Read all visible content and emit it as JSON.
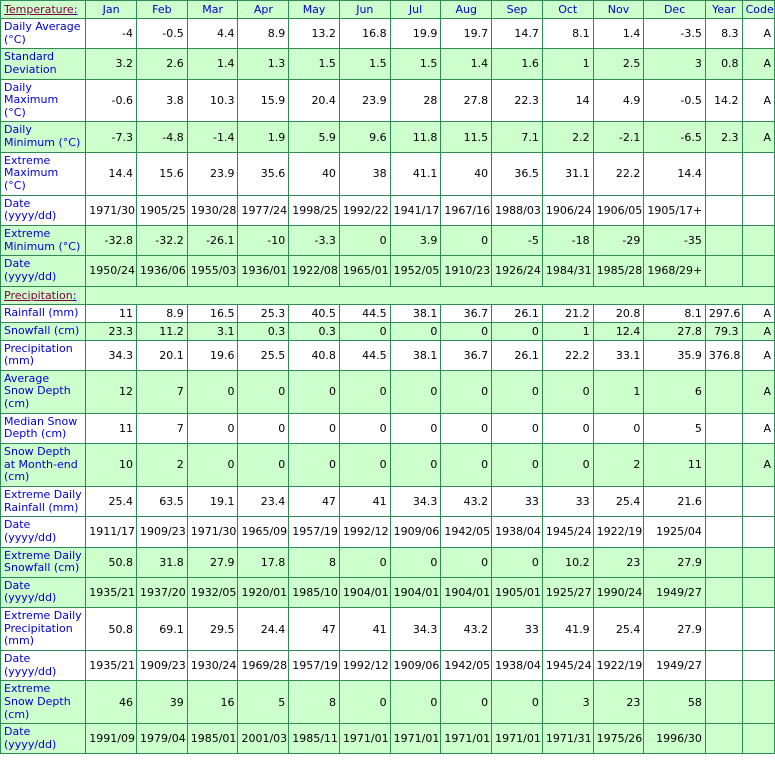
{
  "table": {
    "columns": [
      "Jan",
      "Feb",
      "Mar",
      "Apr",
      "May",
      "Jun",
      "Jul",
      "Aug",
      "Sep",
      "Oct",
      "Nov",
      "Dec",
      "Year",
      "Code"
    ],
    "sections": [
      {
        "title": "Temperature",
        "title_colon": ":",
        "rows": [
          {
            "label": "Daily Average (°C)",
            "shade": "white",
            "values": [
              "-4",
              "-0.5",
              "4.4",
              "8.9",
              "13.2",
              "16.8",
              "19.9",
              "19.7",
              "14.7",
              "8.1",
              "1.4",
              "-3.5",
              "8.3",
              "A"
            ],
            "bold": [
              false,
              false,
              false,
              false,
              false,
              false,
              false,
              false,
              false,
              false,
              false,
              false,
              false,
              false
            ]
          },
          {
            "label": "Standard Deviation",
            "shade": "green",
            "values": [
              "3.2",
              "2.6",
              "1.4",
              "1.3",
              "1.5",
              "1.5",
              "1.5",
              "1.4",
              "1.6",
              "1",
              "2.5",
              "3",
              "0.8",
              "A"
            ],
            "bold": [
              false,
              false,
              false,
              false,
              false,
              false,
              false,
              false,
              false,
              false,
              false,
              false,
              false,
              false
            ]
          },
          {
            "label": "Daily Maximum (°C)",
            "shade": "white",
            "values": [
              "-0.6",
              "3.8",
              "10.3",
              "15.9",
              "20.4",
              "23.9",
              "28",
              "27.8",
              "22.3",
              "14",
              "4.9",
              "-0.5",
              "14.2",
              "A"
            ],
            "bold": [
              false,
              false,
              false,
              false,
              false,
              false,
              false,
              false,
              false,
              false,
              false,
              false,
              false,
              false
            ]
          },
          {
            "label": "Daily Minimum (°C)",
            "shade": "green",
            "values": [
              "-7.3",
              "-4.8",
              "-1.4",
              "1.9",
              "5.9",
              "9.6",
              "11.8",
              "11.5",
              "7.1",
              "2.2",
              "-2.1",
              "-6.5",
              "2.3",
              "A"
            ],
            "bold": [
              false,
              false,
              false,
              false,
              false,
              false,
              false,
              false,
              false,
              false,
              false,
              false,
              false,
              false
            ]
          },
          {
            "label": "Extreme Maximum (°C)",
            "shade": "white",
            "values": [
              "14.4",
              "15.6",
              "23.9",
              "35.6",
              "40",
              "38",
              "41.1",
              "40",
              "36.5",
              "31.1",
              "22.2",
              "14.4",
              "",
              ""
            ],
            "bold": [
              false,
              false,
              false,
              false,
              false,
              false,
              true,
              false,
              false,
              false,
              false,
              false,
              false,
              false
            ]
          },
          {
            "label": "Date (yyyy/dd)",
            "shade": "white",
            "values": [
              "1971/30",
              "1905/25",
              "1930/28",
              "1977/24",
              "1998/25",
              "1992/22",
              "1941/17",
              "1967/16",
              "1988/03",
              "1906/24",
              "1906/05+",
              "1905/17+",
              "",
              ""
            ],
            "bold": [
              false,
              false,
              false,
              false,
              false,
              false,
              true,
              false,
              false,
              false,
              false,
              false,
              false,
              false
            ]
          },
          {
            "label": "Extreme Minimum (°C)",
            "shade": "green",
            "values": [
              "-32.8",
              "-32.2",
              "-26.1",
              "-10",
              "-3.3",
              "0",
              "3.9",
              "0",
              "-5",
              "-18",
              "-29",
              "-35",
              "",
              ""
            ],
            "bold": [
              false,
              false,
              false,
              false,
              false,
              false,
              false,
              false,
              false,
              false,
              false,
              true,
              false,
              false
            ]
          },
          {
            "label": "Date (yyyy/dd)",
            "shade": "green",
            "values": [
              "1950/24",
              "1936/06",
              "1955/03",
              "1936/01",
              "1922/08+",
              "1965/01",
              "1952/05+",
              "1910/23",
              "1926/24",
              "1984/31",
              "1985/28",
              "1968/29+",
              "",
              ""
            ],
            "bold": [
              false,
              false,
              false,
              false,
              false,
              false,
              false,
              false,
              false,
              false,
              false,
              true,
              false,
              false
            ]
          }
        ]
      },
      {
        "title": "Precipitation",
        "title_colon": ":",
        "rows": [
          {
            "label": "Rainfall (mm)",
            "shade": "white",
            "values": [
              "11",
              "8.9",
              "16.5",
              "25.3",
              "40.5",
              "44.5",
              "38.1",
              "36.7",
              "26.1",
              "21.2",
              "20.8",
              "8.1",
              "297.6",
              "A"
            ],
            "bold": [
              false,
              false,
              false,
              false,
              false,
              false,
              false,
              false,
              false,
              false,
              false,
              false,
              false,
              false
            ]
          },
          {
            "label": "Snowfall (cm)",
            "shade": "green",
            "values": [
              "23.3",
              "11.2",
              "3.1",
              "0.3",
              "0.3",
              "0",
              "0",
              "0",
              "0",
              "1",
              "12.4",
              "27.8",
              "79.3",
              "A"
            ],
            "bold": [
              false,
              false,
              false,
              false,
              false,
              false,
              false,
              false,
              false,
              false,
              false,
              false,
              false,
              false
            ]
          },
          {
            "label": "Precipitation (mm)",
            "shade": "white",
            "values": [
              "34.3",
              "20.1",
              "19.6",
              "25.5",
              "40.8",
              "44.5",
              "38.1",
              "36.7",
              "26.1",
              "22.2",
              "33.1",
              "35.9",
              "376.8",
              "A"
            ],
            "bold": [
              false,
              false,
              false,
              false,
              false,
              false,
              false,
              false,
              false,
              false,
              false,
              false,
              false,
              false
            ]
          },
          {
            "label": "Average Snow Depth (cm)",
            "shade": "green",
            "values": [
              "12",
              "7",
              "0",
              "0",
              "0",
              "0",
              "0",
              "0",
              "0",
              "0",
              "1",
              "6",
              "",
              "A"
            ],
            "bold": [
              false,
              false,
              false,
              false,
              false,
              false,
              false,
              false,
              false,
              false,
              false,
              false,
              false,
              false
            ]
          },
          {
            "label": "Median Snow Depth (cm)",
            "shade": "white",
            "values": [
              "11",
              "7",
              "0",
              "0",
              "0",
              "0",
              "0",
              "0",
              "0",
              "0",
              "0",
              "5",
              "",
              "A"
            ],
            "bold": [
              false,
              false,
              false,
              false,
              false,
              false,
              false,
              false,
              false,
              false,
              false,
              false,
              false,
              false
            ]
          },
          {
            "label": "Snow Depth at Month-end (cm)",
            "shade": "green",
            "values": [
              "10",
              "2",
              "0",
              "0",
              "0",
              "0",
              "0",
              "0",
              "0",
              "0",
              "2",
              "11",
              "",
              "A"
            ],
            "bold": [
              false,
              false,
              false,
              false,
              false,
              false,
              false,
              false,
              false,
              false,
              false,
              false,
              false,
              false
            ]
          },
          {
            "label": "Extreme Daily Rainfall (mm)",
            "shade": "white",
            "values": [
              "25.4",
              "63.5",
              "19.1",
              "23.4",
              "47",
              "41",
              "34.3",
              "43.2",
              "33",
              "33",
              "25.4",
              "21.6",
              "",
              ""
            ],
            "bold": [
              false,
              true,
              false,
              false,
              false,
              false,
              false,
              false,
              false,
              false,
              false,
              false,
              false,
              false
            ]
          },
          {
            "label": "Date (yyyy/dd)",
            "shade": "white",
            "values": [
              "1911/17",
              "1909/23",
              "1971/30",
              "1965/09",
              "1957/19",
              "1992/12",
              "1909/06",
              "1942/05",
              "1938/04",
              "1945/24",
              "1922/19",
              "1925/04",
              "",
              ""
            ],
            "bold": [
              false,
              true,
              false,
              false,
              false,
              false,
              false,
              false,
              false,
              false,
              false,
              false,
              false,
              false
            ]
          },
          {
            "label": "Extreme Daily Snowfall (cm)",
            "shade": "green",
            "values": [
              "50.8",
              "31.8",
              "27.9",
              "17.8",
              "8",
              "0",
              "0",
              "0",
              "0",
              "10.2",
              "23",
              "27.9",
              "",
              ""
            ],
            "bold": [
              true,
              false,
              false,
              false,
              false,
              false,
              false,
              false,
              false,
              false,
              false,
              false,
              false,
              false
            ]
          },
          {
            "label": "Date (yyyy/dd)",
            "shade": "green",
            "values": [
              "1935/21",
              "1937/20",
              "1932/05",
              "1920/01",
              "1985/10",
              "1904/01+",
              "1904/01+",
              "1904/01+",
              "1905/01+",
              "1925/27",
              "1990/24",
              "1949/27",
              "",
              ""
            ],
            "bold": [
              true,
              false,
              false,
              false,
              false,
              false,
              false,
              false,
              false,
              false,
              false,
              false,
              false,
              false
            ]
          },
          {
            "label": "Extreme Daily Precipitation (mm)",
            "shade": "white",
            "values": [
              "50.8",
              "69.1",
              "29.5",
              "24.4",
              "47",
              "41",
              "34.3",
              "43.2",
              "33",
              "41.9",
              "25.4",
              "27.9",
              "",
              ""
            ],
            "bold": [
              false,
              true,
              false,
              false,
              false,
              false,
              false,
              false,
              false,
              false,
              false,
              false,
              false,
              false
            ]
          },
          {
            "label": "Date (yyyy/dd)",
            "shade": "white",
            "values": [
              "1935/21",
              "1909/23",
              "1930/24",
              "1969/28",
              "1957/19",
              "1992/12",
              "1909/06",
              "1942/05",
              "1938/04",
              "1945/24",
              "1922/19",
              "1949/27",
              "",
              ""
            ],
            "bold": [
              false,
              true,
              false,
              false,
              false,
              false,
              false,
              false,
              false,
              false,
              false,
              false,
              false,
              false
            ]
          },
          {
            "label": "Extreme Snow Depth (cm)",
            "shade": "green",
            "values": [
              "46",
              "39",
              "16",
              "5",
              "8",
              "0",
              "0",
              "0",
              "0",
              "3",
              "23",
              "58",
              "",
              ""
            ],
            "bold": [
              false,
              false,
              false,
              false,
              false,
              false,
              false,
              false,
              false,
              false,
              false,
              true,
              false,
              false
            ]
          },
          {
            "label": "Date (yyyy/dd)",
            "shade": "green",
            "values": [
              "1991/09",
              "1979/04",
              "1985/01",
              "2001/03",
              "1985/11",
              "1971/01+",
              "1971/01+",
              "1971/01+",
              "1971/01+",
              "1971/31",
              "1975/26+",
              "1996/30",
              "",
              ""
            ],
            "bold": [
              false,
              false,
              false,
              false,
              false,
              false,
              false,
              false,
              false,
              false,
              false,
              true,
              false,
              false
            ]
          }
        ]
      }
    ]
  },
  "colors": {
    "border": "#2e8b57",
    "header_text": "#0000cc",
    "section_title": "#800040",
    "row_shade": "#ccffcc",
    "row_plain": "#ffffff"
  }
}
